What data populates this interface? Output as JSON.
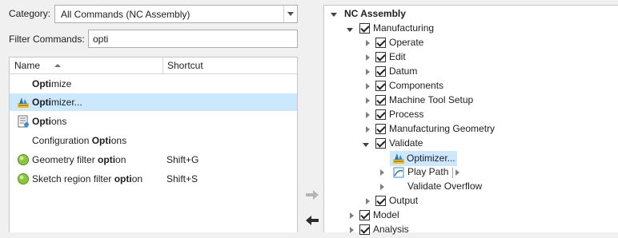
{
  "left": {
    "category_label": "Category:",
    "category_value": "All Commands (NC Assembly)",
    "filter_label": "Filter Commands:",
    "filter_value": "opti",
    "columns": {
      "name": "Name",
      "shortcut": "Shortcut"
    },
    "rows": [
      {
        "pre": "",
        "bold": "Opti",
        "post": "mize",
        "shortcut": "",
        "icon": "none"
      },
      {
        "pre": "",
        "bold": "Opti",
        "post": "mizer...",
        "shortcut": "",
        "icon": "optimizer-icon",
        "selected": true
      },
      {
        "pre": "",
        "bold": "Opti",
        "post": "ons",
        "shortcut": "",
        "icon": "options-icon"
      },
      {
        "pre": "Configuration ",
        "bold": "Opti",
        "post": "ons",
        "shortcut": "",
        "icon": "none"
      },
      {
        "pre": "Geometry filter ",
        "bold": "opti",
        "post": "on",
        "shortcut": "Shift+G",
        "icon": "green-ball-icon"
      },
      {
        "pre": "Sketch region filter ",
        "bold": "opti",
        "post": "on",
        "shortcut": "Shift+S",
        "icon": "green-ball-icon"
      }
    ]
  },
  "tree": {
    "root": "NC Assembly",
    "manufacturing": "Manufacturing",
    "children": [
      "Operate",
      "Edit",
      "Datum",
      "Components",
      "Machine Tool Setup",
      "Process",
      "Manufacturing Geometry"
    ],
    "validate": "Validate",
    "optimizer": "Optimizer...",
    "play_path": "Play Path",
    "validate_overflow": "Validate Overflow",
    "output": "Output",
    "model": "Model",
    "analysis": "Analysis"
  }
}
